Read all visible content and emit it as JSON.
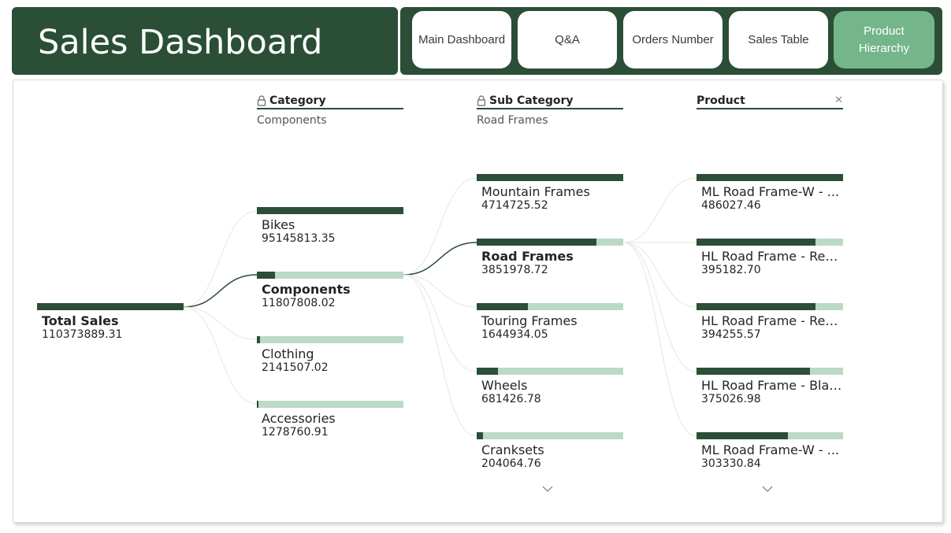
{
  "header": {
    "title": "Sales Dashboard"
  },
  "nav": [
    {
      "label": "Main Dashboard"
    },
    {
      "label": "Q&A"
    },
    {
      "label": "Orders Number"
    },
    {
      "label": "Sales Table"
    },
    {
      "label": "Product Hierarchy",
      "active": true
    }
  ],
  "tree": {
    "root": {
      "label": "Total Sales",
      "value": "110373889.31"
    },
    "category": {
      "header": "Category",
      "selected": "Components",
      "items": [
        {
          "label": "Bikes",
          "value": "95145813.35",
          "share": 1.0
        },
        {
          "label": "Components",
          "value": "11807808.02",
          "share": 0.124,
          "selected": true
        },
        {
          "label": "Clothing",
          "value": "2141507.02",
          "share": 0.0225
        },
        {
          "label": "Accessories",
          "value": "1278760.91",
          "share": 0.0134
        }
      ]
    },
    "subcategory": {
      "header": "Sub Category",
      "selected": "Road Frames",
      "items": [
        {
          "label": "Mountain Frames",
          "value": "4714725.52",
          "share": 1.0
        },
        {
          "label": "Road Frames",
          "value": "3851978.72",
          "share": 0.817,
          "selected": true
        },
        {
          "label": "Touring Frames",
          "value": "1644934.05",
          "share": 0.349
        },
        {
          "label": "Wheels",
          "value": "681426.78",
          "share": 0.145
        },
        {
          "label": "Cranksets",
          "value": "204064.76",
          "share": 0.043
        }
      ]
    },
    "product": {
      "header": "Product",
      "close_icon": "✕",
      "items": [
        {
          "label": "ML Road Frame-W - ...",
          "value": "486027.46",
          "share": 1.0
        },
        {
          "label": "HL Road Frame - Red,...",
          "value": "395182.70",
          "share": 0.813
        },
        {
          "label": "HL Road Frame - Red,...",
          "value": "394255.57",
          "share": 0.811
        },
        {
          "label": "HL Road Frame - Blac...",
          "value": "375026.98",
          "share": 0.772
        },
        {
          "label": "ML Road Frame-W - ...",
          "value": "303330.84",
          "share": 0.624
        }
      ]
    }
  },
  "colors": {
    "dark_green": "#2b4e36",
    "light_green": "#bcd9c5",
    "active_button": "#74b68a"
  }
}
